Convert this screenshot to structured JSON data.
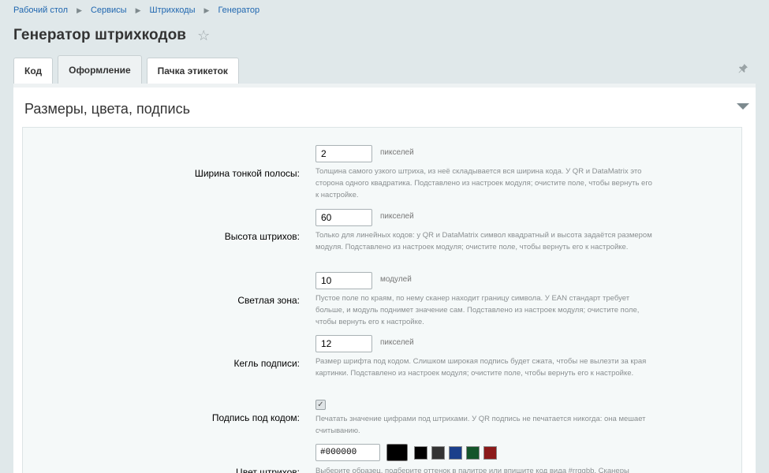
{
  "breadcrumb": [
    "Рабочий стол",
    "Сервисы",
    "Штрихкоды",
    "Генератор"
  ],
  "page_title": "Генератор штрихкодов",
  "tabs": [
    {
      "label": "Код",
      "active": false
    },
    {
      "label": "Оформление",
      "active": true
    },
    {
      "label": "Пачка этикеток",
      "active": false
    }
  ],
  "section_title": "Размеры, цвета, подпись",
  "fields": {
    "bar_width": {
      "label": "Ширина тонкой полосы:",
      "value": "2",
      "unit": "пикселей",
      "hint": "Толщина самого узкого штриха, из неё складывается вся ширина кода. У QR и DataMatrix это сторона одного квадратика. Подставлено из настроек модуля; очистите поле, чтобы вернуть его к настройке."
    },
    "bar_height": {
      "label": "Высота штрихов:",
      "value": "60",
      "unit": "пикселей",
      "hint": "Только для линейных кодов: у QR и DataMatrix символ квадратный и высота задаётся размером модуля. Подставлено из настроек модуля; очистите поле, чтобы вернуть его к настройке."
    },
    "quiet_zone": {
      "label": "Светлая зона:",
      "value": "10",
      "unit": "модулей",
      "hint": "Пустое поле по краям, по нему сканер находит границу символа. У EAN стандарт требует больше, и модуль поднимет значение сам. Подставлено из настроек модуля; очистите поле, чтобы вернуть его к настройке."
    },
    "caption_size": {
      "label": "Кегль подписи:",
      "value": "12",
      "unit": "пикселей",
      "hint": "Размер шрифта под кодом. Слишком широкая подпись будет сжата, чтобы не вылезти за края картинки. Подставлено из настроек модуля; очистите поле, чтобы вернуть его к настройке."
    },
    "show_caption": {
      "label": "Подпись под кодом:",
      "checked": true,
      "check_glyph": "✓",
      "hint": "Печатать значение цифрами под штрихами. У QR подпись не печатается никогда: она мешает считыванию."
    },
    "bar_color": {
      "label": "Цвет штрихов:",
      "value": "#000000",
      "swatches": [
        "#000000",
        "#333333",
        "#1b3f8b",
        "#14552a",
        "#8b1a1a"
      ],
      "hint": "Выберите образец, подберите оттенок в палитре или впишите код вида #rrggbb. Сканеры"
    }
  }
}
